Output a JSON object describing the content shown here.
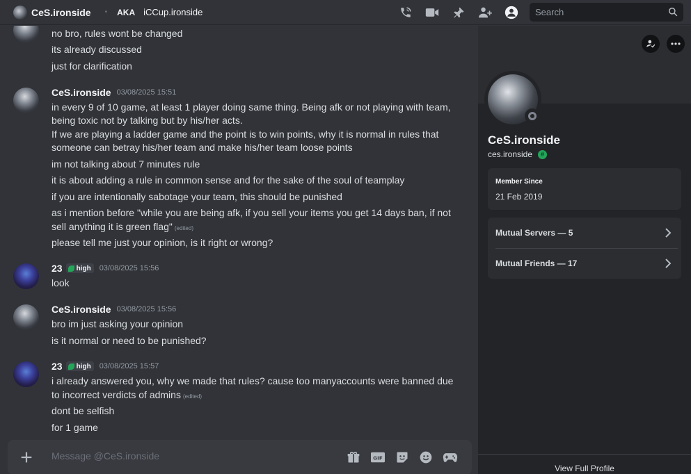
{
  "header": {
    "dm_name": "CeS.ironside",
    "aka_label": "AKA",
    "aka_name": "iCCup.ironside",
    "search_placeholder": "Search",
    "icons": [
      "voice-call-icon",
      "video-call-icon",
      "pin-icon",
      "add-friend-icon",
      "user-profile-icon",
      "search-icon"
    ]
  },
  "messages": [
    {
      "user": "CeS.ironside",
      "lines": [
        "no bro, rules wont be changed",
        "its already discussed",
        "just for clarification"
      ]
    },
    {
      "user": "CeS.ironside",
      "time": "03/08/2025 15:51",
      "lines": [
        "in every 9 of 10 game, at least 1 player doing same thing. Being afk or not playing with team,",
        "being toxic not by talking but by his/her acts.",
        "If we are playing a ladder game and the point is to win points, why it is normal in rules that",
        "someone can betray his/her team and make his/her team loose points",
        "im not talking about 7 minutes rule",
        "it is about adding a rule in common sense and for the sake of the soul of teamplay",
        "if you are intentionally sabotage your team, this should be punished",
        "as i mention before \"while you are being afk, if you sell your items you get 14 days ban, if not",
        "sell anything it is green flag\"",
        "please tell me just your opinion, is it right or wrong?"
      ],
      "edited": "(edited)"
    },
    {
      "user": "23",
      "tag": "high",
      "time": "03/08/2025 15:56",
      "lines": [
        "look"
      ]
    },
    {
      "user": "CeS.ironside",
      "time": "03/08/2025 15:56",
      "lines": [
        "bro im just asking your opinion",
        "is it normal or need to be punished?"
      ]
    },
    {
      "user": "23",
      "tag": "high",
      "time": "03/08/2025 15:57",
      "lines": [
        "i already answered you, why we made that rules? cause too manyaccounts were banned due",
        "to incorrect verdicts of admins",
        "dont be selfish",
        "for 1 game"
      ],
      "edited": "(edited)"
    }
  ],
  "composer": {
    "placeholder": "Message @CeS.ironside",
    "icons": [
      "gift-icon",
      "gif-icon",
      "sticker-icon",
      "emoji-icon",
      "activities-icon"
    ]
  },
  "profile": {
    "name": "CeS.ironside",
    "handle": "ces.ironside",
    "badge": "#",
    "member_since_label": "Member Since",
    "member_since_value": "21 Feb 2019",
    "mutual_servers": "Mutual Servers — 5",
    "mutual_friends": "Mutual Friends — 17",
    "view_full": "View Full Profile"
  },
  "colors": {
    "background": "#313338",
    "panel": "#232428",
    "accent_green": "#23a55a"
  }
}
